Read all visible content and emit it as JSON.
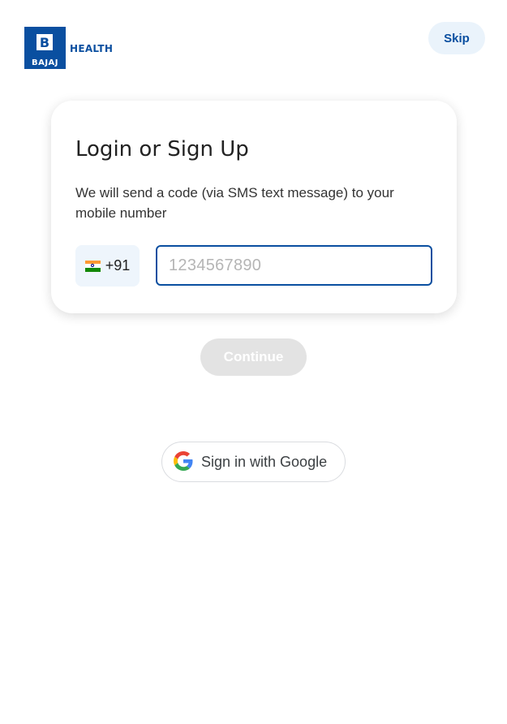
{
  "brand": {
    "logo_letter": "B",
    "logo_text": "BAJAJ",
    "logo_subtitle": "HEALTH",
    "primary_color": "#0a4fa0"
  },
  "header": {
    "skip_label": "Skip"
  },
  "card": {
    "title": "Login or Sign Up",
    "description": "We will send a code (via SMS text message) to your mobile number",
    "country_flag_icon": "india-flag-icon",
    "country_code": "+91",
    "phone_placeholder": "1234567890",
    "phone_value": ""
  },
  "actions": {
    "continue_label": "Continue",
    "continue_disabled": true,
    "google_label": "Sign in with Google",
    "google_icon": "google-g-icon"
  }
}
